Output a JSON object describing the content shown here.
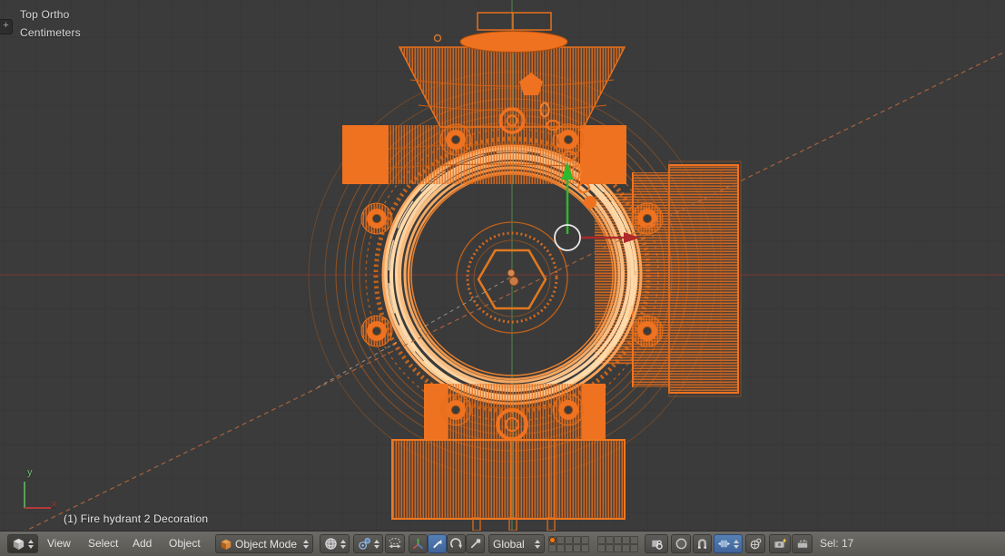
{
  "viewport": {
    "view_label": "Top Ortho",
    "units_label": "Centimeters",
    "status_text": "(1) Fire hydrant 2 Decoration",
    "region_tab_glyph": "+",
    "gizmo": {
      "x_label": "x",
      "y_label": "y"
    },
    "scene_object": "Fire hydrant 2 Decoration",
    "display_mode": "wireframe-selected"
  },
  "header": {
    "editor_type_icon": "3d-viewport-editor-icon",
    "menus": [
      "View",
      "Select",
      "Add",
      "Object"
    ],
    "mode_dropdown": {
      "label": "Object Mode",
      "icon": "object-mode-cube-icon"
    },
    "shading_dropdown": {
      "icon": "viewport-shading-sphere-icon"
    },
    "pivot_dropdown": {
      "icon": "pivot-point-icon"
    },
    "center_points_toggle": {
      "icon": "manipulate-center-points-icon",
      "pressed": false
    },
    "manipulator_buttons": [
      {
        "name": "manipulator-toggle",
        "icon": "axis-tripod-icon",
        "pressed": false
      },
      {
        "name": "translate",
        "icon": "translate-arrow-icon",
        "pressed": true
      },
      {
        "name": "rotate",
        "icon": "rotate-arc-icon",
        "pressed": false
      },
      {
        "name": "scale",
        "icon": "scale-arrow-icon",
        "pressed": false
      }
    ],
    "orientation_dropdown": {
      "label": "Global"
    },
    "layers": {
      "count": 20,
      "active_index": 0
    },
    "lock_to_scene": {
      "icon": "lock-camera-to-view-icon"
    },
    "proportional_dropdown": {
      "icon": "proportional-edit-circle-icon"
    },
    "snap_toggle": {
      "icon": "magnet-icon",
      "pressed": false
    },
    "snap_element_dropdown": {
      "icon": "snap-increment-icon",
      "pressed": true
    },
    "snap_target_dropdown": {
      "icon": "snap-target-icon"
    },
    "opengl_render_image": {
      "icon": "camera-render-icon"
    },
    "opengl_render_anim": {
      "icon": "clapperboard-icon"
    },
    "selection_count_label": "Sel: 17"
  },
  "colors": {
    "viewport_background": "#3b3b3b",
    "grid_line": "#343434",
    "selection_orange": "#f4781f",
    "wire_bright": "#ffd9a8",
    "wire_dark": "#9a5520",
    "axis_x_red": "#6e3636",
    "axis_y_green": "#4e7c4e",
    "manipulator_green": "#2eb82e",
    "manipulator_red": "#b02828",
    "manipulator_circle_white": "#e9e9e9",
    "dashed_relationship_line": "#b4663c",
    "pressed_button_blue": "#4a74ab"
  }
}
